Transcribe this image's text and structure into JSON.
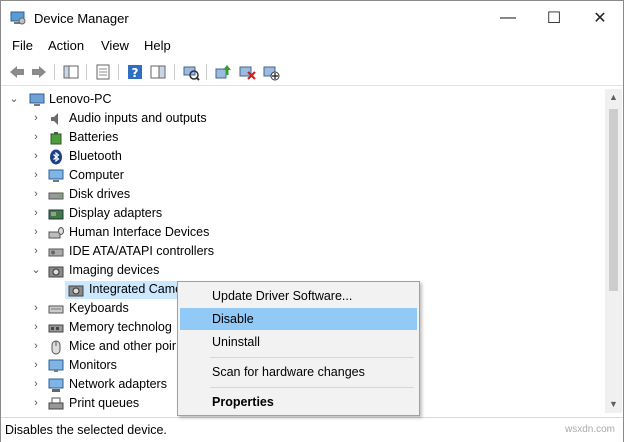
{
  "window": {
    "title": "Device Manager"
  },
  "menu": [
    "File",
    "Action",
    "View",
    "Help"
  ],
  "caption": {
    "minimize": "—",
    "maximize": "☐",
    "close": "✕"
  },
  "tree": {
    "root": "Lenovo-PC",
    "items": [
      {
        "label": "Audio inputs and outputs",
        "icon": "speaker-icon",
        "state": "collapsed"
      },
      {
        "label": "Batteries",
        "icon": "battery-icon",
        "state": "collapsed"
      },
      {
        "label": "Bluetooth",
        "icon": "bluetooth-icon",
        "state": "collapsed"
      },
      {
        "label": "Computer",
        "icon": "computer-icon",
        "state": "collapsed"
      },
      {
        "label": "Disk drives",
        "icon": "disk-drive-icon",
        "state": "collapsed"
      },
      {
        "label": "Display adapters",
        "icon": "display-adapter-icon",
        "state": "collapsed"
      },
      {
        "label": "Human Interface Devices",
        "icon": "hid-icon",
        "state": "collapsed"
      },
      {
        "label": "IDE ATA/ATAPI controllers",
        "icon": "ide-controller-icon",
        "state": "collapsed"
      },
      {
        "label": "Imaging devices",
        "icon": "camera-icon",
        "state": "expanded"
      },
      {
        "label": "Integrated Came",
        "icon": "camera-icon",
        "state": "child-selected"
      },
      {
        "label": "Keyboards",
        "icon": "keyboard-icon",
        "state": "collapsed"
      },
      {
        "label": "Memory technolog",
        "icon": "memory-icon",
        "state": "collapsed"
      },
      {
        "label": "Mice and other poir",
        "icon": "mouse-icon",
        "state": "collapsed"
      },
      {
        "label": "Monitors",
        "icon": "monitor-icon",
        "state": "collapsed"
      },
      {
        "label": "Network adapters",
        "icon": "network-icon",
        "state": "collapsed"
      },
      {
        "label": "Print queues",
        "icon": "printer-icon",
        "state": "collapsed"
      }
    ]
  },
  "context_menu": {
    "items": [
      {
        "label": "Update Driver Software...",
        "highlighted": false,
        "bold": false
      },
      {
        "label": "Disable",
        "highlighted": true,
        "bold": false
      },
      {
        "label": "Uninstall",
        "highlighted": false,
        "bold": false
      },
      {
        "label": "Scan for hardware changes",
        "highlighted": false,
        "bold": false
      },
      {
        "label": "Properties",
        "highlighted": false,
        "bold": true
      }
    ]
  },
  "status": {
    "text": "Disables the selected device."
  },
  "watermark": "wsxdn.com",
  "colors": {
    "highlight": "#91c9f7",
    "selection": "#cce8ff",
    "accent": "#0078d7"
  }
}
